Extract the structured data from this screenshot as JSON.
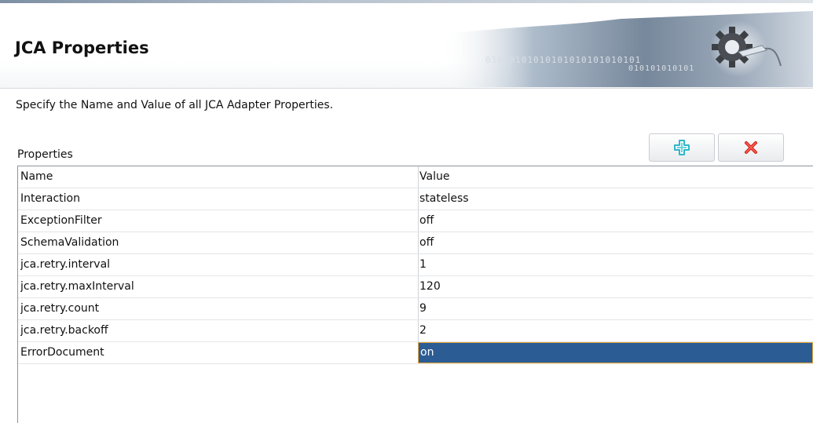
{
  "header": {
    "title": "JCA Properties",
    "banner_binary_1": "01010101010101010101010101",
    "banner_binary_2": "010101010101",
    "gear_icon": "gear-plug-icon"
  },
  "description": "Specify the Name and Value of all JCA Adapter Properties.",
  "properties": {
    "label": "Properties",
    "add_icon": "plus-icon",
    "delete_icon": "x-icon",
    "add_color": "#2fb7c8",
    "delete_color": "#d8261b",
    "columns": [
      "Name",
      "Value"
    ],
    "rows": [
      {
        "name": "Interaction",
        "value": "stateless"
      },
      {
        "name": "ExceptionFilter",
        "value": "off"
      },
      {
        "name": "SchemaValidation",
        "value": "off"
      },
      {
        "name": "jca.retry.interval",
        "value": "1"
      },
      {
        "name": "jca.retry.maxInterval",
        "value": "120"
      },
      {
        "name": "jca.retry.count",
        "value": "9"
      },
      {
        "name": "jca.retry.backoff",
        "value": "2"
      },
      {
        "name": "ErrorDocument",
        "value": "on"
      }
    ],
    "selection_color": "#2b5d94",
    "selection_border": "#e8a63c"
  }
}
